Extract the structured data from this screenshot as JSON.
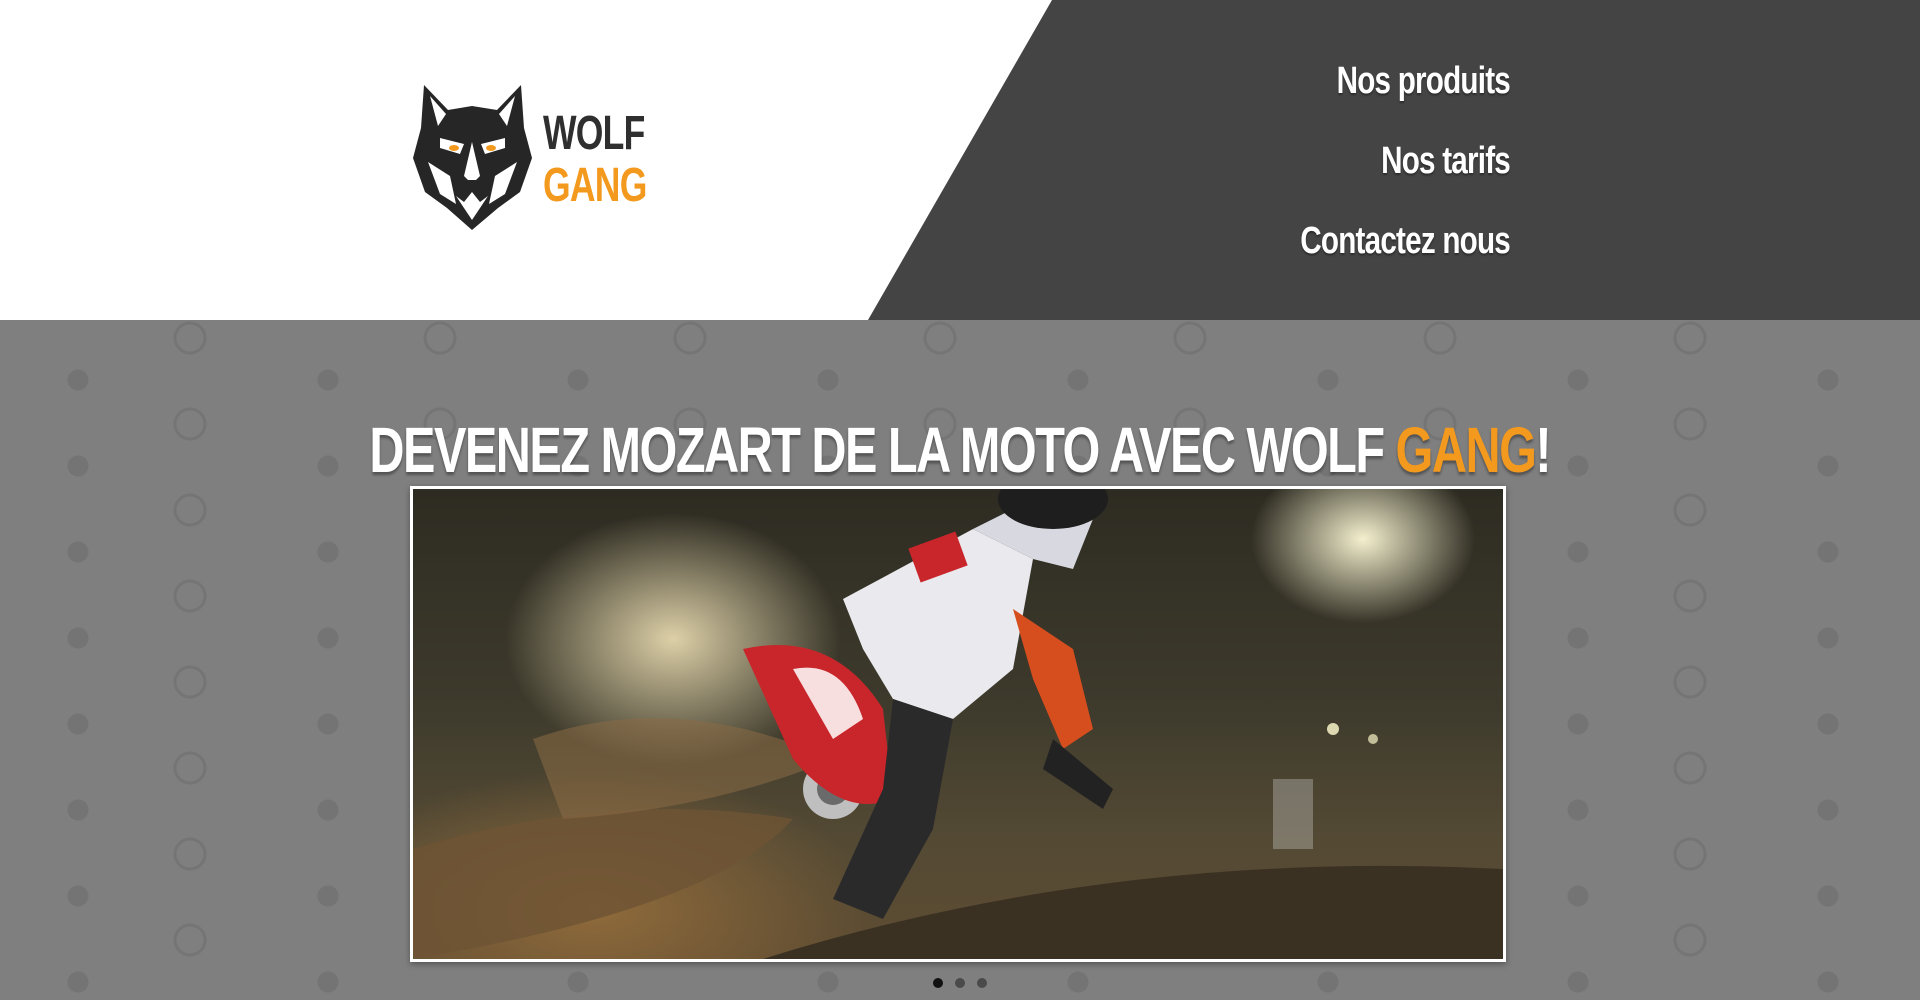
{
  "brand": {
    "word1": "WOLF",
    "word2": "GANG",
    "logo_icon": "wolf-head-icon"
  },
  "nav": {
    "items": [
      {
        "label": "Nos produits"
      },
      {
        "label": "Nos tarifs"
      },
      {
        "label": "Contactez nous"
      }
    ]
  },
  "hero": {
    "title_main": "DEVENEZ MOZART DE LA MOTO AVEC WOLF ",
    "title_accent": "GANG",
    "title_end": "!",
    "background_icon": "motorcycle-helmet-icon"
  },
  "slider": {
    "slide_count": 3,
    "active_index": 0,
    "image_subject": "motocross-rider-photo"
  },
  "colors": {
    "accent": "#f39a1e",
    "header_dark": "#444444",
    "hero_bg": "#7f7f7f",
    "text_light": "#ffffff"
  }
}
